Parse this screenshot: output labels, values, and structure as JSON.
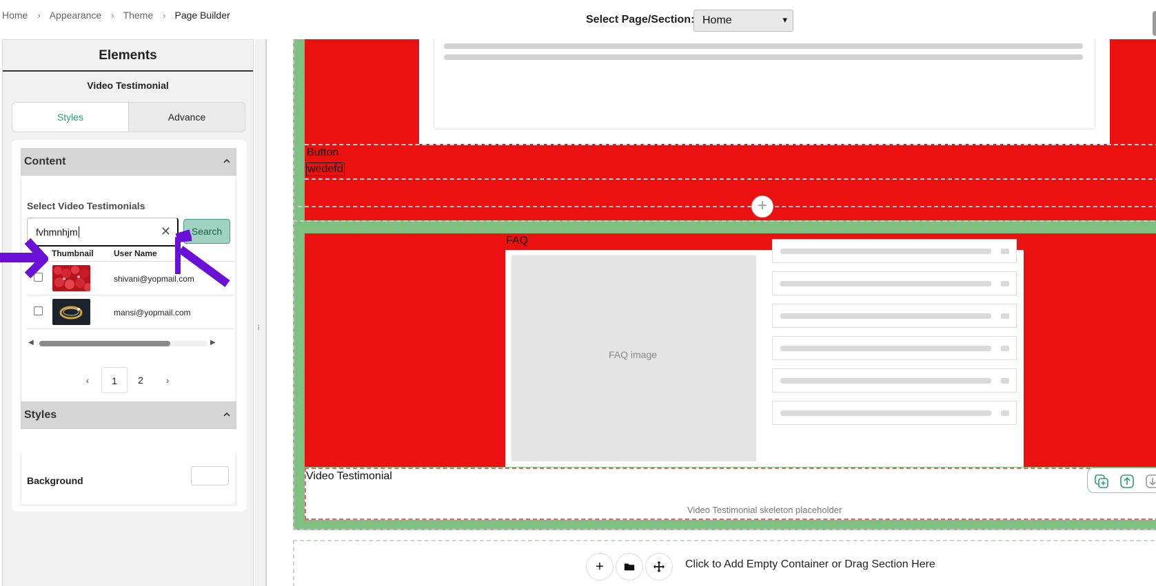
{
  "breadcrumb": {
    "items": [
      "Home",
      "Appearance",
      "Theme",
      "Page Builder"
    ]
  },
  "page_select": {
    "label": "Select Page/Section:",
    "value": "Home"
  },
  "panel": {
    "title": "Elements",
    "subtitle": "Video Testimonial",
    "tabs": [
      "Styles",
      "Advance"
    ],
    "active_tab": "Styles",
    "content_section": {
      "title": "Content",
      "select_label": "Select Video Testimonials",
      "search_value": "fvhmnhjm",
      "search_button": "Search",
      "columns": [
        "Thumbnail",
        "User Name"
      ],
      "rows": [
        {
          "user": "shivani@yopmail.com",
          "checked": false,
          "thumb": "red-berries-image"
        },
        {
          "user": "mansi@yopmail.com",
          "checked": false,
          "thumb": "gold-ring-image"
        }
      ],
      "pages": [
        "1",
        "2"
      ],
      "current_page": "1"
    },
    "styles_section": {
      "title": "Styles",
      "background_label": "Background"
    }
  },
  "canvas": {
    "button_label": "Button",
    "button_value": "wedefd",
    "faq_label": "FAQ",
    "faq_image_label": "FAQ image",
    "video_testimonial_label": "Video Testimonial",
    "video_placeholder": "Video Testimonial skeleton placeholder",
    "empty_container_text": "Click to Add Empty Container or Drag Section Here"
  },
  "colors": {
    "accent_green": "#2aa06e",
    "section_red": "#ec1111",
    "section_green": "#7fbf7f",
    "annotation_purple": "#6a0fd6"
  }
}
